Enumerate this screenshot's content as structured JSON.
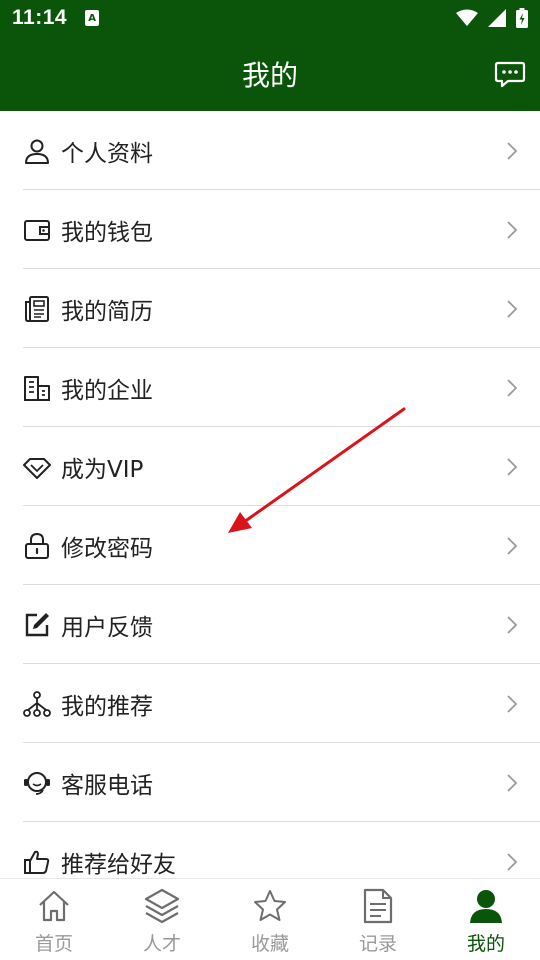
{
  "status_bar": {
    "time": "11:14",
    "notification_glyph": "A",
    "icons": [
      "wifi-icon",
      "signal-icon",
      "battery-icon"
    ]
  },
  "header": {
    "title": "我的",
    "message_icon": "chat-bubble-icon"
  },
  "menu": {
    "items": [
      {
        "label": "个人资料",
        "icon": "user-icon"
      },
      {
        "label": "我的钱包",
        "icon": "wallet-icon"
      },
      {
        "label": "我的简历",
        "icon": "resume-icon"
      },
      {
        "label": "我的企业",
        "icon": "building-icon"
      },
      {
        "label": "成为VIP",
        "icon": "diamond-icon"
      },
      {
        "label": "修改密码",
        "icon": "lock-icon"
      },
      {
        "label": "用户反馈",
        "icon": "edit-icon"
      },
      {
        "label": "我的推荐",
        "icon": "network-icon"
      },
      {
        "label": "客服电话",
        "icon": "headset-icon"
      },
      {
        "label": "推荐给好友",
        "icon": "thumbs-up-icon"
      }
    ]
  },
  "bottom_nav": {
    "tabs": [
      {
        "label": "首页",
        "icon": "home-icon"
      },
      {
        "label": "人才",
        "icon": "layers-icon"
      },
      {
        "label": "收藏",
        "icon": "star-icon"
      },
      {
        "label": "记录",
        "icon": "document-icon"
      },
      {
        "label": "我的",
        "icon": "person-icon"
      }
    ],
    "active_index": 4
  },
  "colors": {
    "primary": "#0a5509",
    "divider": "#dcdcdc",
    "inactive_tab": "#9a9a9a",
    "annotation_arrow": "#d9141c"
  }
}
